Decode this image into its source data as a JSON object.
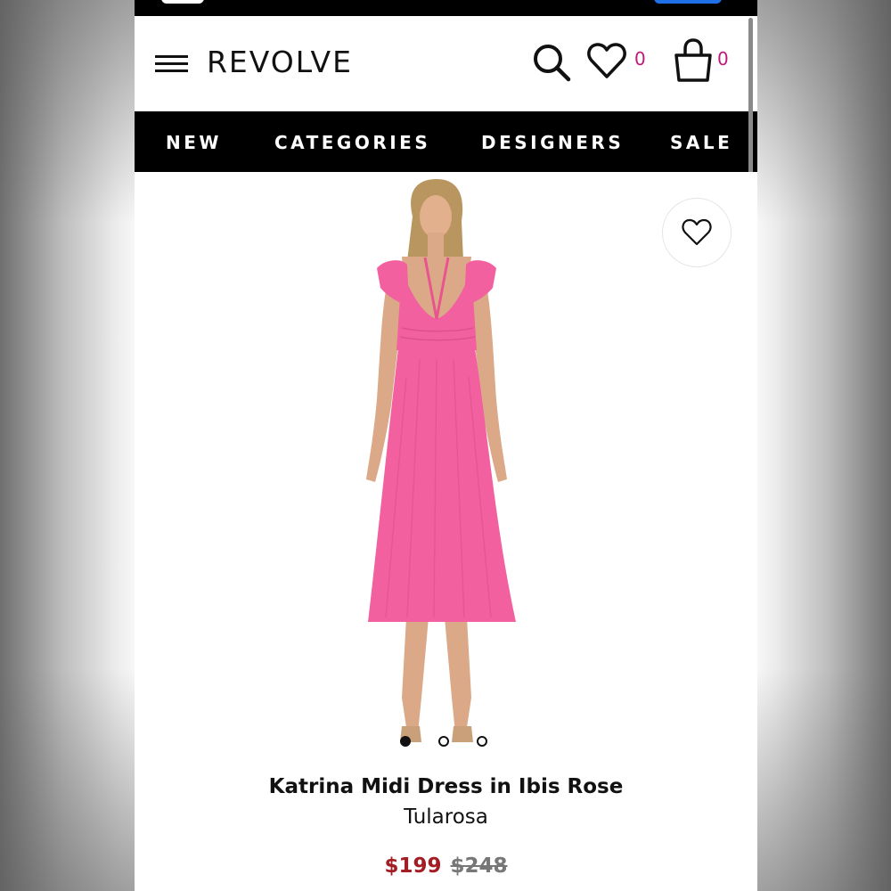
{
  "header": {
    "logo": "REVOLVE",
    "wishlist_count": "0",
    "bag_count": "0"
  },
  "nav": {
    "items": [
      "NEW",
      "CATEGORIES",
      "DESIGNERS",
      "SALE"
    ]
  },
  "product": {
    "name": "Katrina Midi Dress in Ibis Rose",
    "designer": "Tularosa",
    "sale_price": "$199",
    "original_price": "$248",
    "image_count": 3,
    "active_image": 1,
    "dress_color": "#f2609f"
  },
  "icons": {
    "menu": "hamburger-menu-icon",
    "search": "search-icon",
    "wishlist": "heart-icon",
    "bag": "shopping-bag-icon",
    "favorite": "heart-outline-icon"
  },
  "colors": {
    "badge": "#c0187b",
    "sale_price": "#a31d25",
    "nav_background": "#000000"
  }
}
